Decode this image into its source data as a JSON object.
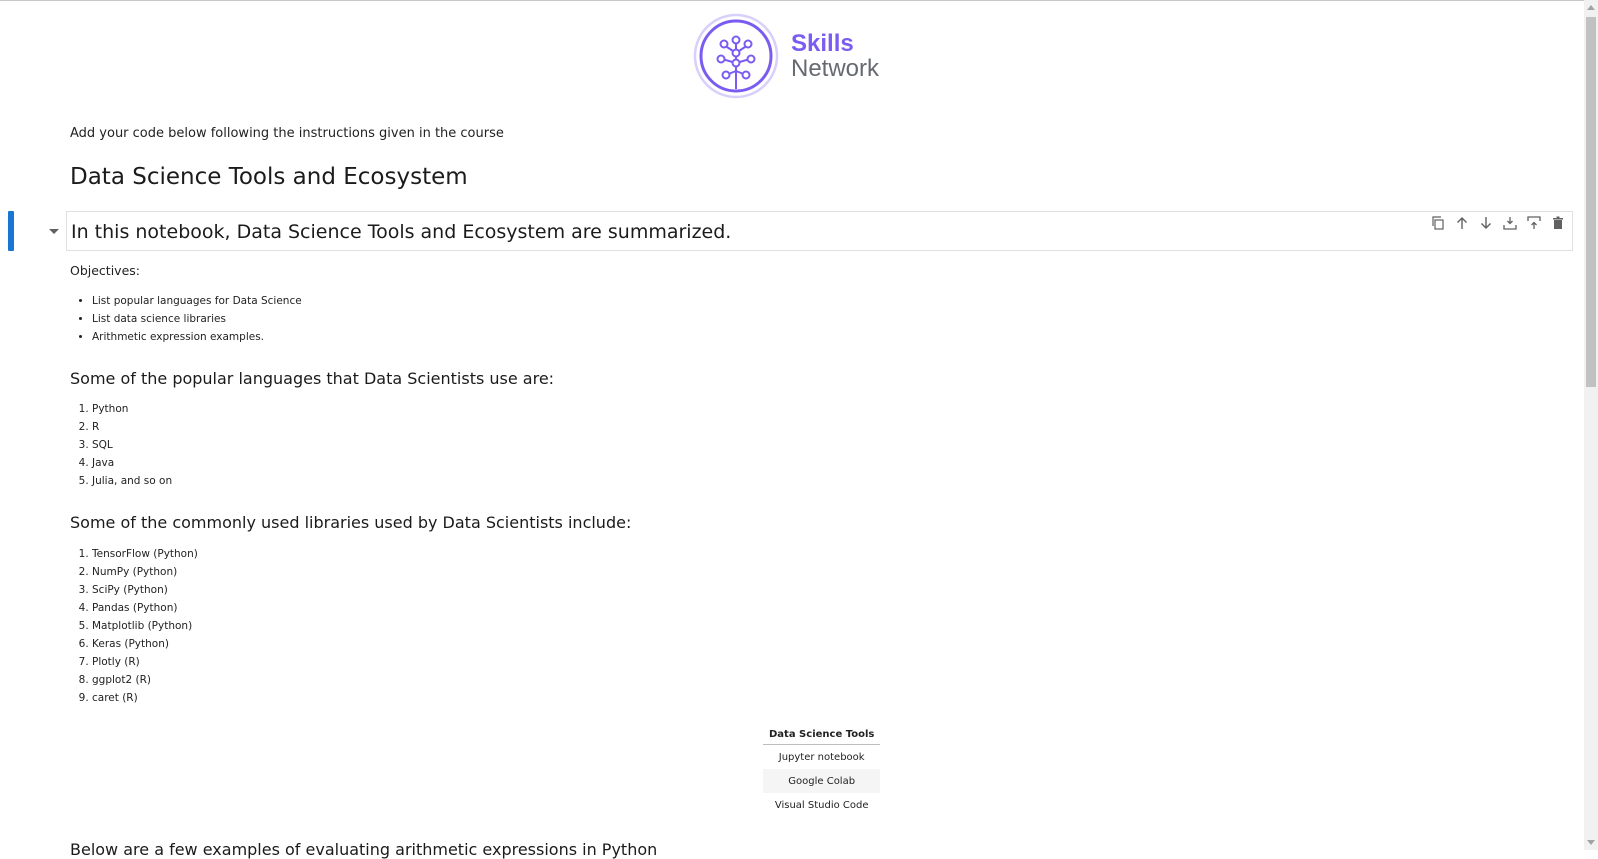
{
  "logo": {
    "line1": "Skills",
    "line2": "Network",
    "colors": {
      "accent": "#7a5cf0",
      "secondary": "#666a70"
    }
  },
  "intro_text": "Add your code below following the instructions given in the course",
  "title": "Data Science Tools and Ecosystem",
  "active_cell": {
    "heading": "In this notebook, Data Science Tools and Ecosystem are summarized.",
    "toolbar": [
      {
        "name": "duplicate-cell",
        "icon": "copy-icon"
      },
      {
        "name": "move-up",
        "icon": "arrow-up-icon"
      },
      {
        "name": "move-down",
        "icon": "arrow-down-icon"
      },
      {
        "name": "insert-below",
        "icon": "insert-below-icon"
      },
      {
        "name": "insert-above",
        "icon": "insert-above-icon"
      },
      {
        "name": "delete-cell",
        "icon": "trash-icon"
      }
    ],
    "colors": {
      "active_bar": "#1976d2"
    }
  },
  "objectives": {
    "label": "Objectives:",
    "items": [
      "List popular languages for Data Science",
      "List data science libraries",
      "Arithmetic expression examples."
    ]
  },
  "languages": {
    "heading": "Some of the popular languages that Data Scientists use are:",
    "items": [
      "Python",
      "R",
      "SQL",
      "Java",
      "Julia, and so on"
    ]
  },
  "libraries": {
    "heading": "Some of the commonly used libraries used by Data Scientists include:",
    "items": [
      "TensorFlow (Python)",
      "NumPy (Python)",
      "SciPy (Python)",
      "Pandas (Python)",
      "Matplotlib (Python)",
      "Keras (Python)",
      "Plotly (R)",
      "ggplot2 (R)",
      "caret (R)"
    ]
  },
  "tools_table": {
    "header": "Data Science Tools",
    "rows": [
      "Jupyter notebook",
      "Google Colab",
      "Visual Studio Code"
    ]
  },
  "cut_text": "Below are a few examples of evaluating arithmetic expressions in Python"
}
